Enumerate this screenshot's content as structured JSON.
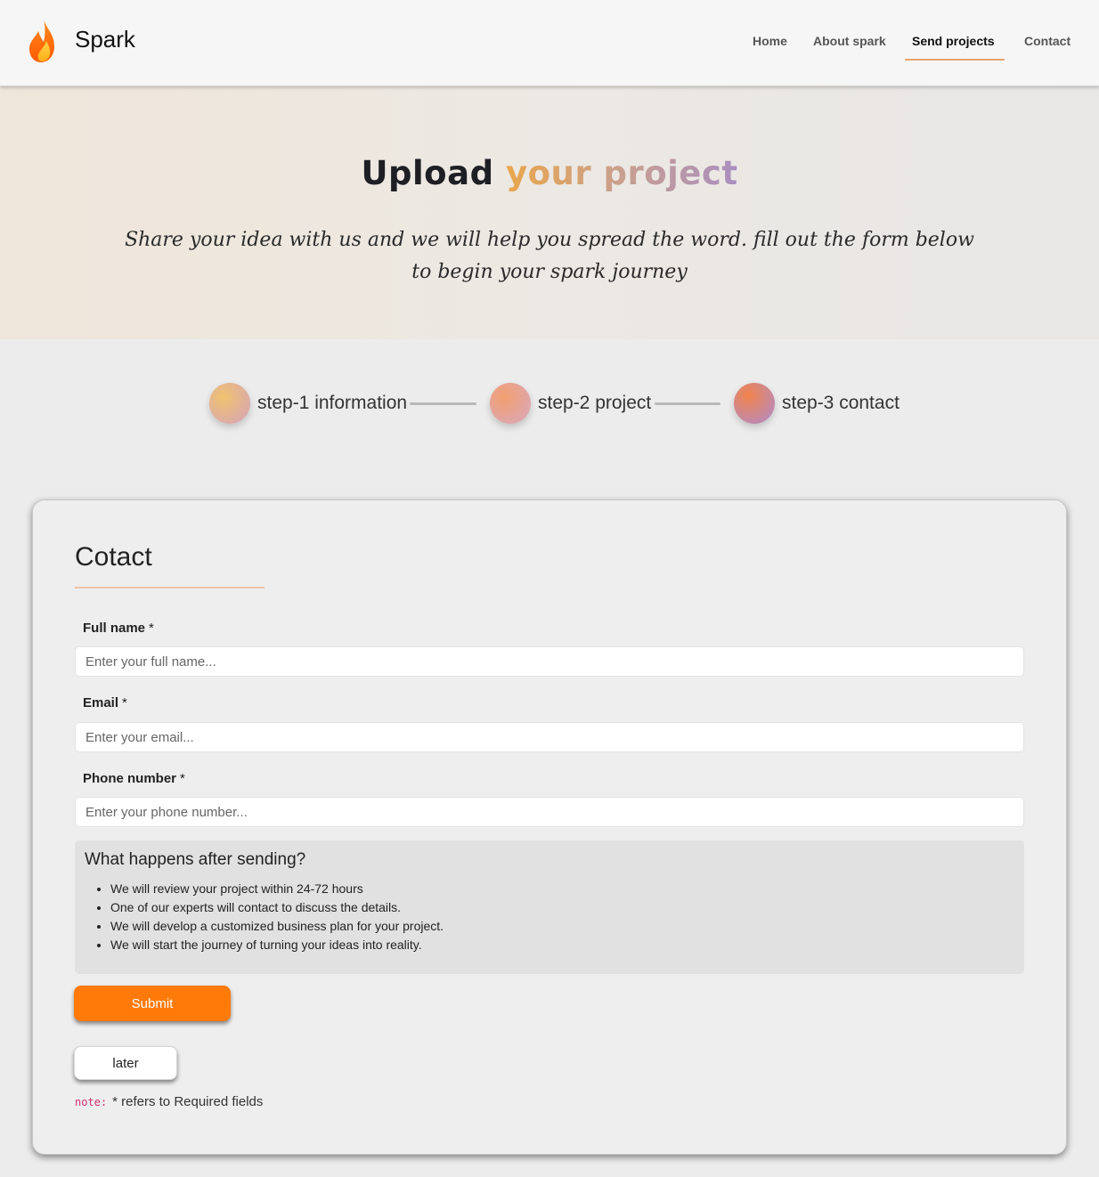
{
  "header": {
    "brand": "Spark",
    "logo_icon": "flame-icon",
    "nav": [
      {
        "label": "Home",
        "active": false
      },
      {
        "label": "About spark",
        "active": false
      },
      {
        "label": "Send projects",
        "active": true
      },
      {
        "label": "Contact",
        "active": false
      }
    ],
    "accent": "#e8a36b"
  },
  "hero": {
    "title_plain": "Upload",
    "title_highlight": "your project",
    "subtitle": "Share your idea with us and we will help you spread the word. fill out the form below to begin your spark journey"
  },
  "steps": [
    {
      "label": "step-1 information"
    },
    {
      "label": "step-2 project"
    },
    {
      "label": "step-3 contact"
    }
  ],
  "form": {
    "title": "Cotact",
    "required_mark": "*",
    "fields": [
      {
        "label": "Full name",
        "placeholder": "Enter your full name...",
        "value": ""
      },
      {
        "label": "Email",
        "placeholder": "Enter your email...",
        "value": ""
      },
      {
        "label": "Phone number",
        "placeholder": "Enter your phone number...",
        "value": ""
      }
    ],
    "info": {
      "title": "What happens after sending?",
      "items": [
        "We will review your project within 24-72 hours",
        "One of our experts will contact to discuss the details.",
        "We will develop a customized business plan for your project.",
        "We will start the journey of turning your ideas into reality."
      ]
    },
    "submit_label": "Submit",
    "later_label": "later",
    "note_code": "note:",
    "note_text": "* refers to Required fields",
    "submit_color": "#ff7a08"
  }
}
